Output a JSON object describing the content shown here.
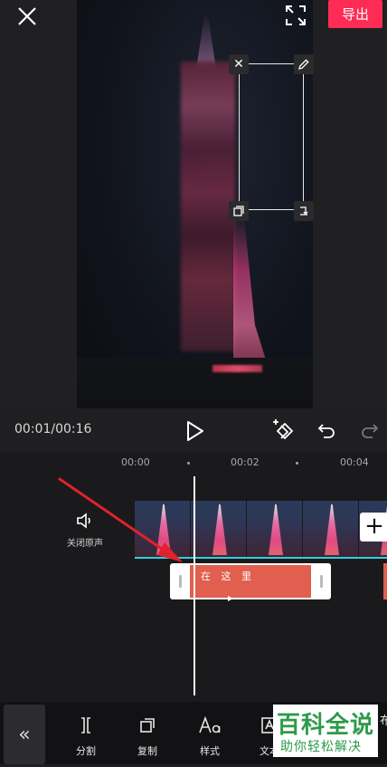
{
  "topbar": {
    "export_label": "导出"
  },
  "player": {
    "timecode": "00:01/00:16"
  },
  "timeline": {
    "ticks": [
      "00:00",
      "00:02",
      "00:04"
    ],
    "mute_label": "关闭原声",
    "text_clip_label": "在 这 里"
  },
  "toolbar": {
    "items": [
      {
        "label": "分割",
        "icon": "split-icon"
      },
      {
        "label": "复制",
        "icon": "copy-icon"
      },
      {
        "label": "样式",
        "icon": "style-icon"
      },
      {
        "label": "文本",
        "icon": "text-icon"
      }
    ],
    "partial_label": "布"
  },
  "watermark": {
    "title": "百科全说",
    "subtitle": "助你轻松解决"
  },
  "colors": {
    "accent": "#fe2c55",
    "text_clip": "#e05f4e",
    "track_line": "#2bd0e0",
    "annotation": "#e0212e"
  }
}
